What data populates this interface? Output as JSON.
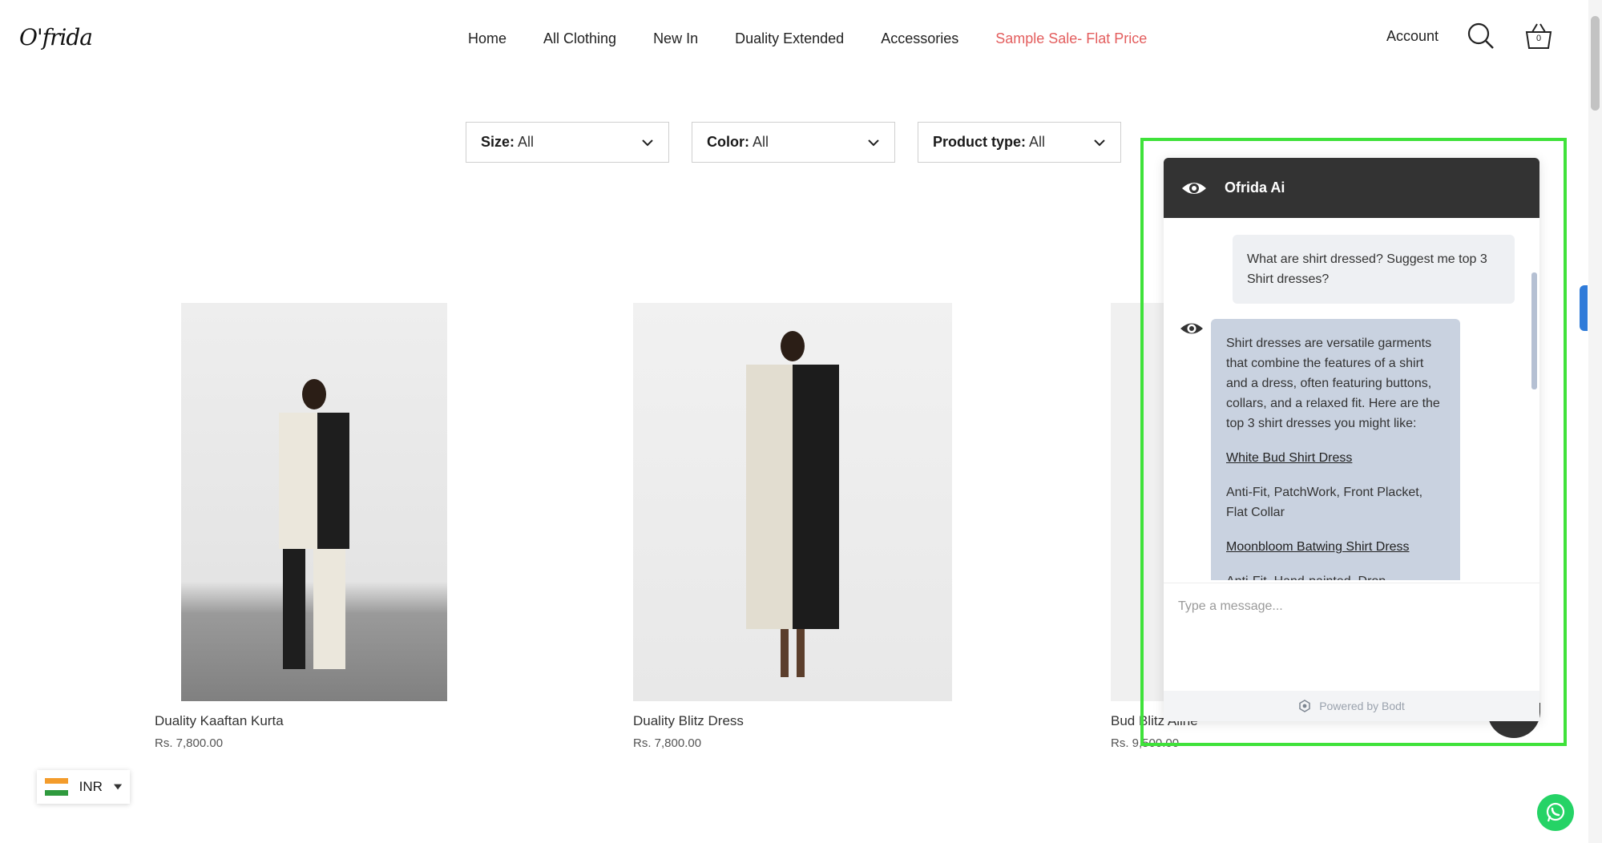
{
  "header": {
    "logo": "O'frida",
    "nav": [
      "Home",
      "All Clothing",
      "New In",
      "Duality Extended",
      "Accessories",
      "Sample Sale- Flat Price"
    ],
    "account_label": "Account",
    "cart_count": "0"
  },
  "filters": [
    {
      "label": "Size:",
      "value": "All"
    },
    {
      "label": "Color:",
      "value": "All"
    },
    {
      "label": "Product type:",
      "value": "All"
    }
  ],
  "products": [
    {
      "name": "Duality Kaaftan Kurta",
      "price": "Rs. 7,800.00"
    },
    {
      "name": "Duality Blitz Dress",
      "price": "Rs. 7,800.00"
    },
    {
      "name": "Bud Blitz Aline",
      "price": "Rs. 9,500.00"
    }
  ],
  "currency": {
    "code": "INR"
  },
  "chat": {
    "title": "Ofrida Ai",
    "user_message": "What are shirt dressed? Suggest me top 3 Shirt dresses?",
    "bot_intro": "Shirt dresses are versatile garments that combine the features of a shirt and a dress, often featuring buttons, collars, and a relaxed fit. Here are the top 3 shirt dresses you might like:",
    "link1": "White Bud Shirt Dress",
    "desc1": "Anti-Fit, PatchWork, Front Placket, Flat Collar",
    "link2": "Moonbloom Batwing Shirt Dress",
    "desc2_partial": "Anti-Fit, Hand-painted, Drop",
    "input_placeholder": "Type a message...",
    "powered_by": "Powered by Bodt"
  },
  "colors": {
    "sale": "#e35d5d",
    "chat_header": "#333333",
    "bot_bubble": "#c9d2e0",
    "highlight": "#3fe23a",
    "whatsapp": "#25d366"
  }
}
